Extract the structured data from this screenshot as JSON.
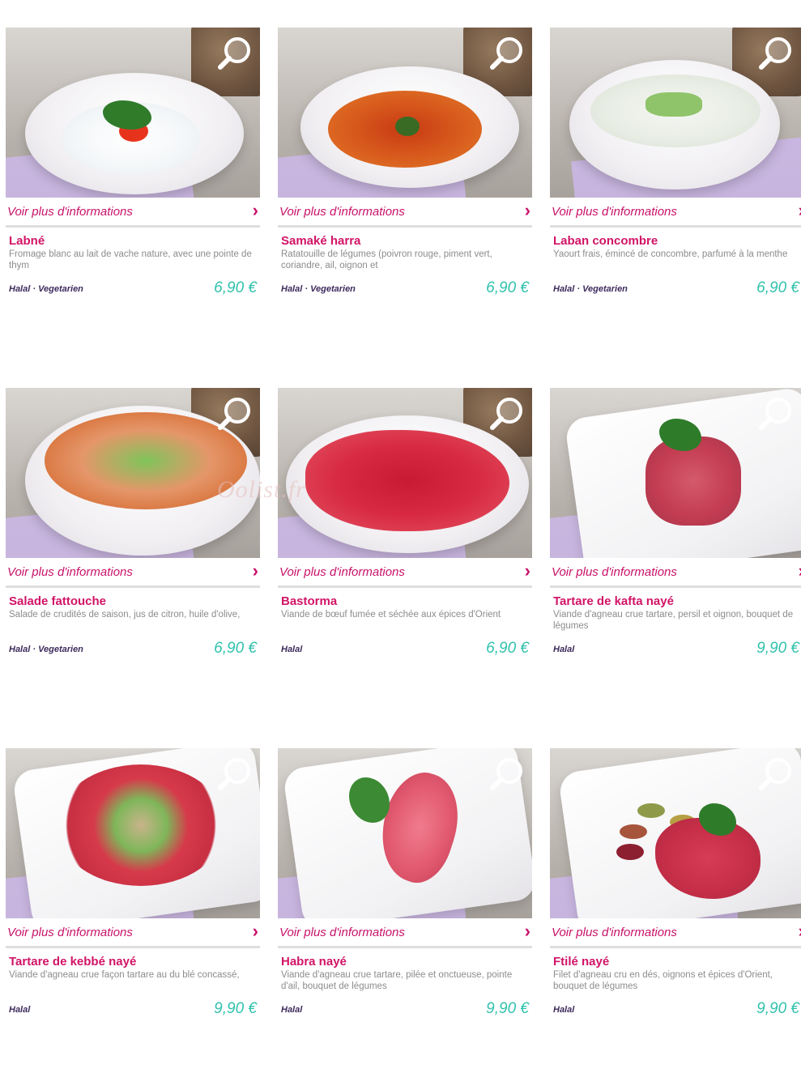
{
  "info_label": "Voir plus d'informations",
  "watermark": "Oolist.fr",
  "colors": {
    "accent": "#d11466",
    "price": "#30c2ad",
    "tag": "#3e2a5c",
    "desc": "#8c8c8c"
  },
  "icons": {
    "zoom": "magnifier-icon",
    "arrow": "chevron-right-icon"
  },
  "items": [
    {
      "name": "Labné",
      "desc": "Fromage blanc au lait de vache nature, avec une pointe de thym",
      "tags": "Halal · Vegetarien",
      "price": "6,90 €"
    },
    {
      "name": "Samaké harra",
      "desc": "Ratatouille de légumes (poivron rouge, piment vert, coriandre, ail, oignon et",
      "tags": "Halal · Vegetarien",
      "price": "6,90 €"
    },
    {
      "name": "Laban concombre",
      "desc": "Yaourt frais, émincé de concombre, parfumé à la menthe",
      "tags": "Halal · Vegetarien",
      "price": "6,90 €"
    },
    {
      "name": "Salade fattouche",
      "desc": "Salade de crudités de saison, jus de citron, huile d'olive,",
      "tags": "Halal · Vegetarien",
      "price": "6,90 €"
    },
    {
      "name": "Bastorma",
      "desc": "Viande de bœuf fumée et séchée aux épices d'Orient",
      "tags": "Halal",
      "price": "6,90 €"
    },
    {
      "name": "Tartare de kafta nayé",
      "desc": "Viande d'agneau crue tartare, persil et oignon, bouquet de légumes",
      "tags": "Halal",
      "price": "9,90 €"
    },
    {
      "name": "Tartare de kebbé nayé",
      "desc": "Viande d'agneau crue façon tartare au du blé concassé,",
      "tags": "Halal",
      "price": "9,90 €"
    },
    {
      "name": "Habra nayé",
      "desc": "Viande d'agneau crue tartare, pilée et onctueuse, pointe d'ail, bouquet de légumes",
      "tags": "Halal",
      "price": "9,90 €"
    },
    {
      "name": "Ftilé nayé",
      "desc": "Filet d'agneau cru en dés, oignons et épices d'Orient, bouquet de légumes",
      "tags": "Halal",
      "price": "9,90 €"
    }
  ]
}
